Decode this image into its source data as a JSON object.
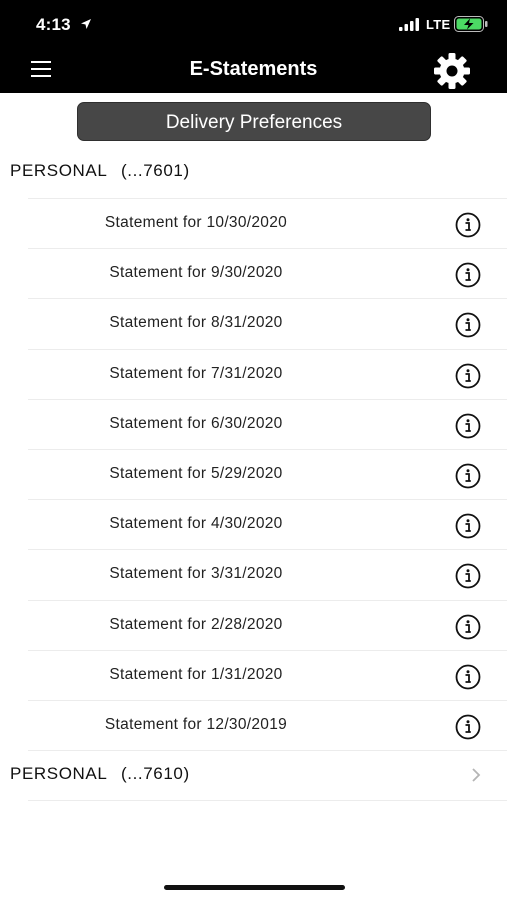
{
  "status_bar": {
    "time": "4:13",
    "network": "LTE"
  },
  "nav": {
    "title": "E-Statements",
    "menu_icon": "hamburger-menu-icon",
    "settings_icon": "gear-icon"
  },
  "preferences_button": {
    "label": "Delivery Preferences"
  },
  "accounts": [
    {
      "name": "PERSONAL",
      "number": "(...7601)",
      "expanded": true,
      "statements": [
        "Statement for 10/30/2020",
        "Statement for 9/30/2020",
        "Statement for 8/31/2020",
        "Statement for 7/31/2020",
        "Statement for 6/30/2020",
        "Statement for 5/29/2020",
        "Statement for 4/30/2020",
        "Statement for 3/31/2020",
        "Statement for 2/28/2020",
        "Statement for 1/31/2020",
        "Statement for 12/30/2019"
      ]
    },
    {
      "name": "PERSONAL",
      "number": "(...7610)",
      "expanded": false,
      "statements": []
    }
  ],
  "colors": {
    "header_bg": "#000000",
    "button_bg": "#474747",
    "battery_fill": "#4cd964"
  }
}
